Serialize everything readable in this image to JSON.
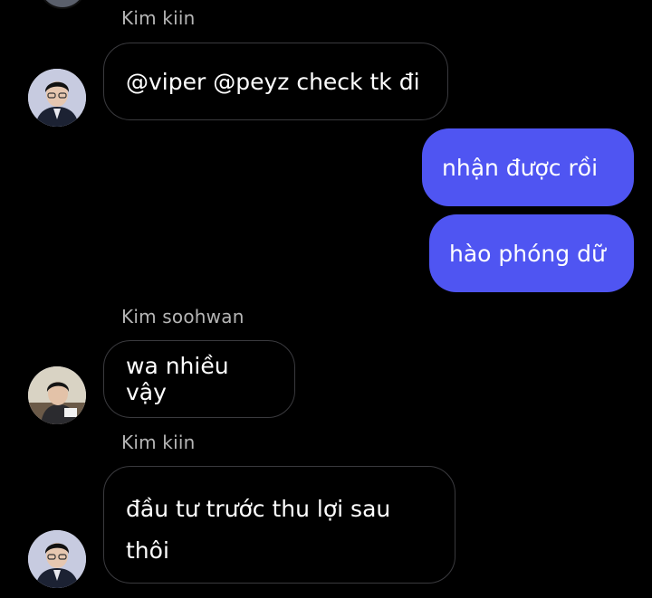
{
  "colors": {
    "background": "#000000",
    "outgoing_bubble": "#4f55f2",
    "incoming_border": "#3a3a3e",
    "sender_name": "#b5b5b5"
  },
  "messages": [
    {
      "sender": "Kim kiin",
      "text": "@viper @peyz check tk đi",
      "avatar": "kiin-avatar"
    },
    {
      "outgoing": true,
      "text": "nhận được rồi"
    },
    {
      "outgoing": true,
      "text": "hào phóng dữ"
    },
    {
      "sender": "Kim soohwan",
      "text": "wa nhiều vậy",
      "avatar": "soohwan-avatar"
    },
    {
      "sender": "Kim kiin",
      "text_lines": [
        "đầu tư trước thu lợi sau",
        "thôi"
      ],
      "avatar": "kiin-avatar"
    }
  ]
}
